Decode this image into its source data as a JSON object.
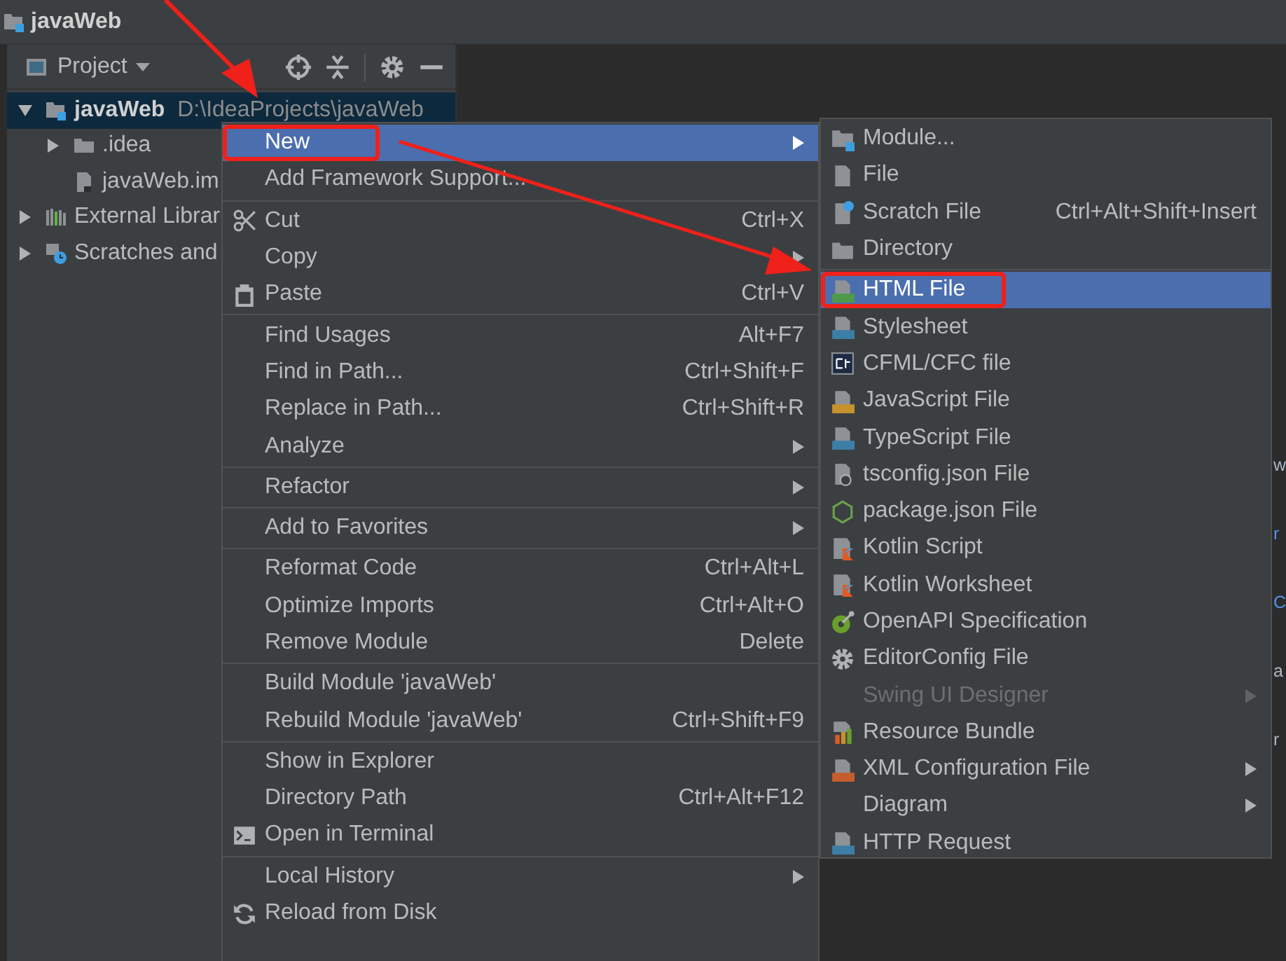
{
  "window": {
    "title": "javaWeb"
  },
  "tool_window": {
    "title": "Project"
  },
  "tree": [
    {
      "label": "javaWeb",
      "hint": "D:\\IdeaProjects\\javaWeb",
      "kind": "module",
      "expanded": true,
      "selected": true,
      "children": [
        {
          "label": ".idea",
          "kind": "folder",
          "expanded": false,
          "selected": false
        },
        {
          "label": "javaWeb.im",
          "kind": "iml",
          "selected": false
        }
      ]
    },
    {
      "label": "External Librar",
      "kind": "library",
      "expanded": false,
      "selected": false
    },
    {
      "label": "Scratches and",
      "kind": "scratches",
      "expanded": false,
      "selected": false
    }
  ],
  "editor_fragments": [
    {
      "text": "w",
      "color": "#a9b7c6"
    },
    {
      "text": "r",
      "color": "#5394ec"
    },
    {
      "text": "C",
      "color": "#5394ec"
    },
    {
      "text": "a",
      "color": "#a9b7c6"
    },
    {
      "text": "r",
      "color": "#a9b7c6"
    }
  ],
  "context_menu": [
    [
      {
        "label": "New",
        "has_submenu": true,
        "selected": true,
        "annotated": true
      },
      {
        "label": "Add Framework Support...",
        "has_submenu": false,
        "selected": false,
        "annotated": false
      }
    ],
    [
      {
        "label": "Cut",
        "shortcut": "Ctrl+X",
        "kind": "scissors",
        "has_submenu": false,
        "selected": false,
        "annotated": false
      },
      {
        "label": "Copy",
        "has_submenu": true,
        "selected": false,
        "annotated": false
      },
      {
        "label": "Paste",
        "shortcut": "Ctrl+V",
        "kind": "clipboard",
        "has_submenu": false,
        "selected": false,
        "annotated": false
      }
    ],
    [
      {
        "label": "Find Usages",
        "shortcut": "Alt+F7",
        "has_submenu": false,
        "selected": false,
        "annotated": false
      },
      {
        "label": "Find in Path...",
        "shortcut": "Ctrl+Shift+F",
        "has_submenu": false,
        "selected": false,
        "annotated": false
      },
      {
        "label": "Replace in Path...",
        "shortcut": "Ctrl+Shift+R",
        "has_submenu": false,
        "selected": false,
        "annotated": false
      },
      {
        "label": "Analyze",
        "has_submenu": true,
        "selected": false,
        "annotated": false
      }
    ],
    [
      {
        "label": "Refactor",
        "has_submenu": true,
        "selected": false,
        "annotated": false
      }
    ],
    [
      {
        "label": "Add to Favorites",
        "has_submenu": true,
        "selected": false,
        "annotated": false
      }
    ],
    [
      {
        "label": "Reformat Code",
        "shortcut": "Ctrl+Alt+L",
        "has_submenu": false,
        "selected": false,
        "annotated": false
      },
      {
        "label": "Optimize Imports",
        "shortcut": "Ctrl+Alt+O",
        "has_submenu": false,
        "selected": false,
        "annotated": false
      },
      {
        "label": "Remove Module",
        "shortcut": "Delete",
        "has_submenu": false,
        "selected": false,
        "annotated": false
      }
    ],
    [
      {
        "label": "Build Module 'javaWeb'",
        "has_submenu": false,
        "selected": false,
        "annotated": false
      },
      {
        "label": "Rebuild Module 'javaWeb'",
        "shortcut": "Ctrl+Shift+F9",
        "has_submenu": false,
        "selected": false,
        "annotated": false
      }
    ],
    [
      {
        "label": "Show in Explorer",
        "has_submenu": false,
        "selected": false,
        "annotated": false
      },
      {
        "label": "Directory Path",
        "shortcut": "Ctrl+Alt+F12",
        "has_submenu": false,
        "selected": false,
        "annotated": false
      },
      {
        "label": "Open in Terminal",
        "kind": "terminal",
        "has_submenu": false,
        "selected": false,
        "annotated": false
      }
    ],
    [
      {
        "label": "Local History",
        "has_submenu": true,
        "selected": false,
        "annotated": false
      },
      {
        "label": "Reload from Disk",
        "kind": "reload",
        "has_submenu": false,
        "selected": false,
        "annotated": false
      }
    ]
  ],
  "new_submenu": [
    [
      {
        "label": "Module...",
        "kind": "module",
        "has_submenu": false,
        "disabled": false,
        "selected": false,
        "annotated": false
      },
      {
        "label": "File",
        "kind": "file",
        "has_submenu": false,
        "disabled": false,
        "selected": false,
        "annotated": false
      },
      {
        "label": "Scratch File",
        "shortcut": "Ctrl+Alt+Shift+Insert",
        "kind": "scratch",
        "has_submenu": false,
        "disabled": false,
        "selected": false,
        "annotated": false
      },
      {
        "label": "Directory",
        "kind": "folder",
        "has_submenu": false,
        "disabled": false,
        "selected": false,
        "annotated": false
      }
    ],
    [
      {
        "label": "HTML File",
        "kind": "html",
        "has_submenu": false,
        "disabled": false,
        "selected": true,
        "annotated": true
      },
      {
        "label": "Stylesheet",
        "kind": "css",
        "has_submenu": false,
        "disabled": false,
        "selected": false,
        "annotated": false
      },
      {
        "label": "CFML/CFC file",
        "kind": "cf",
        "has_submenu": false,
        "disabled": false,
        "selected": false,
        "annotated": false
      },
      {
        "label": "JavaScript File",
        "kind": "js",
        "has_submenu": false,
        "disabled": false,
        "selected": false,
        "annotated": false
      },
      {
        "label": "TypeScript File",
        "kind": "ts",
        "has_submenu": false,
        "disabled": false,
        "selected": false,
        "annotated": false
      },
      {
        "label": "tsconfig.json File",
        "kind": "tsconfig",
        "has_submenu": false,
        "disabled": false,
        "selected": false,
        "annotated": false
      },
      {
        "label": "package.json File",
        "kind": "nodejs",
        "has_submenu": false,
        "disabled": false,
        "selected": false,
        "annotated": false
      },
      {
        "label": "Kotlin Script",
        "kind": "kotlin",
        "has_submenu": false,
        "disabled": false,
        "selected": false,
        "annotated": false
      },
      {
        "label": "Kotlin Worksheet",
        "kind": "kotlin",
        "has_submenu": false,
        "disabled": false,
        "selected": false,
        "annotated": false
      },
      {
        "label": "OpenAPI Specification",
        "kind": "openapi",
        "has_submenu": false,
        "disabled": false,
        "selected": false,
        "annotated": false
      },
      {
        "label": "EditorConfig File",
        "kind": "gear",
        "has_submenu": false,
        "disabled": false,
        "selected": false,
        "annotated": false
      },
      {
        "label": "Swing UI Designer",
        "has_submenu": true,
        "disabled": true,
        "selected": false,
        "annotated": false
      },
      {
        "label": "Resource Bundle",
        "kind": "bundle",
        "has_submenu": false,
        "disabled": false,
        "selected": false,
        "annotated": false
      },
      {
        "label": "XML Configuration File",
        "kind": "xml",
        "has_submenu": true,
        "disabled": false,
        "selected": false,
        "annotated": false
      },
      {
        "label": "Diagram",
        "has_submenu": true,
        "disabled": false,
        "selected": false,
        "annotated": false
      },
      {
        "label": "HTTP Request",
        "kind": "api",
        "has_submenu": false,
        "disabled": false,
        "selected": false,
        "annotated": false
      }
    ]
  ]
}
